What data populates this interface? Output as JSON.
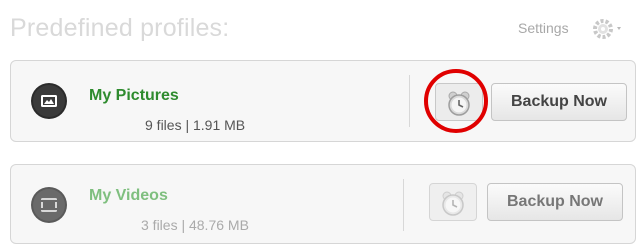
{
  "header": {
    "title": "Predefined profiles:",
    "settings_label": "Settings"
  },
  "profiles": [
    {
      "name": "My Pictures",
      "meta": "9 files | 1.91 MB",
      "icon": "pictures-icon",
      "schedule_icon": "alarm-clock-icon",
      "backup_label": "Backup Now"
    },
    {
      "name": "My Videos",
      "meta": "3 files | 48.76 MB",
      "icon": "videos-icon",
      "schedule_icon": "alarm-clock-icon",
      "backup_label": "Backup Now"
    }
  ],
  "highlight_color": "#e00000"
}
